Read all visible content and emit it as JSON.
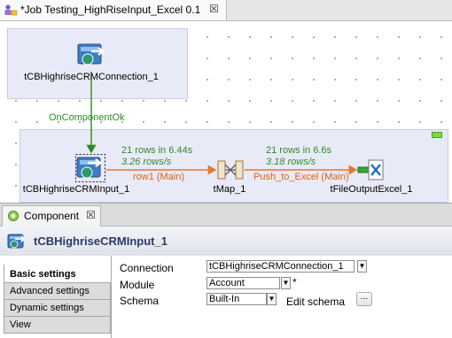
{
  "editor": {
    "tab_title": "*Job Testing_HighRiseInput_Excel 0.1",
    "close_symbol": "☒",
    "icon": "job-icon"
  },
  "canvas": {
    "components": {
      "connection": {
        "label": "tCBHighriseCRMConnection_1",
        "icon": "highrise-connection-icon"
      },
      "input": {
        "label": "tCBHighriseCRMInput_1",
        "icon": "highrise-input-icon"
      },
      "tmap": {
        "label": "tMap_1",
        "icon": "tmap-icon"
      },
      "output": {
        "label": "tFileOutputExcel_1",
        "icon": "excel-output-icon"
      }
    },
    "trigger": {
      "label": "OnComponentOk"
    },
    "flows": {
      "row1": {
        "stats": "21 rows in 6.44s",
        "rate": "3.26 rows/s",
        "label": "row1 (Main)"
      },
      "push": {
        "stats": "21 rows in 6.6s",
        "rate": "3.18 rows/s",
        "label": "Push_to_Excel (Main)"
      }
    },
    "colors": {
      "flow": "#e8782a",
      "trigger": "#2f8a28",
      "subjob": "#e9eaf7"
    }
  },
  "component_view": {
    "tab_title": "Component",
    "close_symbol": "☒",
    "title": "tCBHighriseCRMInput_1",
    "vertical_tabs": [
      {
        "label": "Basic settings",
        "active": true
      },
      {
        "label": "Advanced settings",
        "active": false
      },
      {
        "label": "Dynamic settings",
        "active": false
      },
      {
        "label": "View",
        "active": false
      }
    ],
    "properties": {
      "connection": {
        "label": "Connection",
        "value": "tCBHighriseCRMConnection_1"
      },
      "module": {
        "label": "Module",
        "value": "Account",
        "required_mark": "*"
      },
      "schema": {
        "label": "Schema",
        "value": "Built-In",
        "edit_label": "Edit schema",
        "button": "..."
      }
    },
    "arrow_symbol": "▼"
  }
}
